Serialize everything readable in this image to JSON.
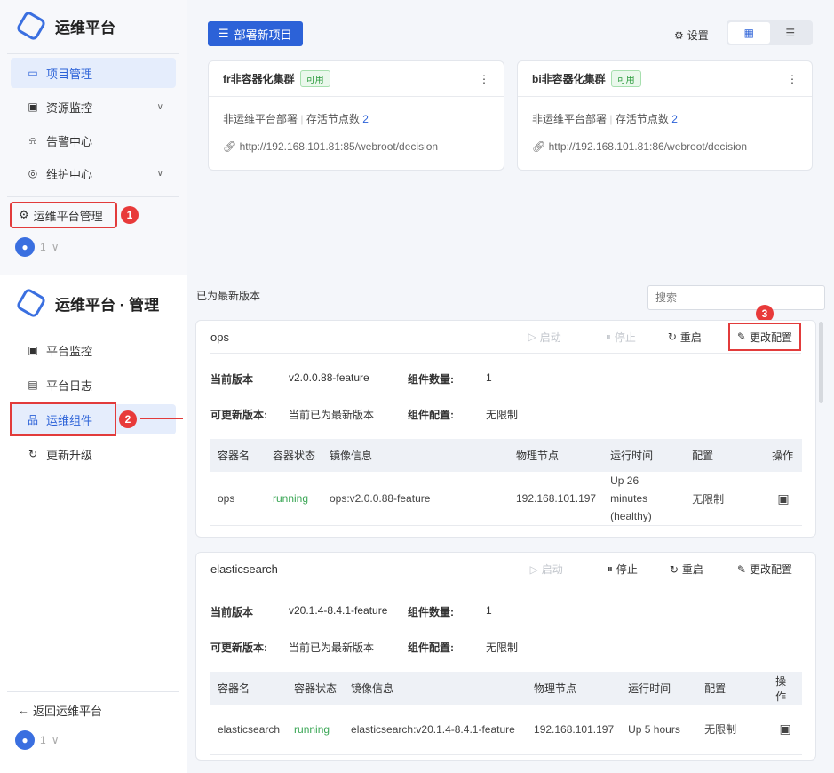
{
  "top": {
    "sidebar": {
      "title": "运维平台",
      "items": [
        {
          "label": "项目管理",
          "icon": "project-icon",
          "active": true
        },
        {
          "label": "资源监控",
          "icon": "monitor-icon",
          "expandable": true
        },
        {
          "label": "告警中心",
          "icon": "alarm-icon"
        },
        {
          "label": "维护中心",
          "icon": "maintain-icon",
          "expandable": true
        }
      ],
      "admin_label": "运维平台管理",
      "user": "1"
    },
    "toolbar": {
      "deploy_label": "部署新项目",
      "settings_label": "设置"
    },
    "clusters": [
      {
        "name": "fr非容器化集群",
        "status": "可用",
        "deploy": "非运维平台部署",
        "nodes_label": "存活节点数",
        "nodes": "2",
        "url": "http://192.168.101.81:85/webroot/decision"
      },
      {
        "name": "bi非容器化集群",
        "status": "可用",
        "deploy": "非运维平台部署",
        "nodes_label": "存活节点数",
        "nodes": "2",
        "url": "http://192.168.101.81:86/webroot/decision"
      }
    ]
  },
  "bottom": {
    "sidebar": {
      "title": "运维平台 · 管理",
      "items": [
        {
          "label": "平台监控"
        },
        {
          "label": "平台日志"
        },
        {
          "label": "运维组件",
          "active": true
        },
        {
          "label": "更新升级"
        }
      ],
      "back_label": "返回运维平台",
      "user": "1"
    },
    "status_text": "已为最新版本",
    "search_placeholder": "搜索",
    "actions": {
      "start": "启动",
      "stop": "停止",
      "restart": "重启",
      "config": "更改配置"
    },
    "labels": {
      "current_version": "当前版本",
      "updatable_version": "可更新版本:",
      "count": "组件数量:",
      "config": "组件配置:"
    },
    "columns": [
      "容器名",
      "容器状态",
      "镜像信息",
      "物理节点",
      "运行时间",
      "配置",
      "操作"
    ],
    "components": [
      {
        "name": "ops",
        "version": "v2.0.0.88-feature",
        "updatable": "当前已为最新版本",
        "count": "1",
        "config": "无限制",
        "row": {
          "container": "ops",
          "state": "running",
          "image": "ops:v2.0.0.88-feature",
          "node": "192.168.101.197",
          "uptime": "Up 26 minutes",
          "uptime2": "(healthy)",
          "config": "无限制"
        }
      },
      {
        "name": "elasticsearch",
        "version": "v20.1.4-8.4.1-feature",
        "updatable": "当前已为最新版本",
        "count": "1",
        "config": "无限制",
        "row": {
          "container": "elasticsearch",
          "state": "running",
          "image": "elasticsearch:v20.1.4-8.4.1-feature",
          "node": "192.168.101.197",
          "uptime": "Up 5 hours",
          "uptime2": "",
          "config": "无限制"
        }
      }
    ]
  },
  "annotations": [
    "1",
    "2",
    "3"
  ]
}
